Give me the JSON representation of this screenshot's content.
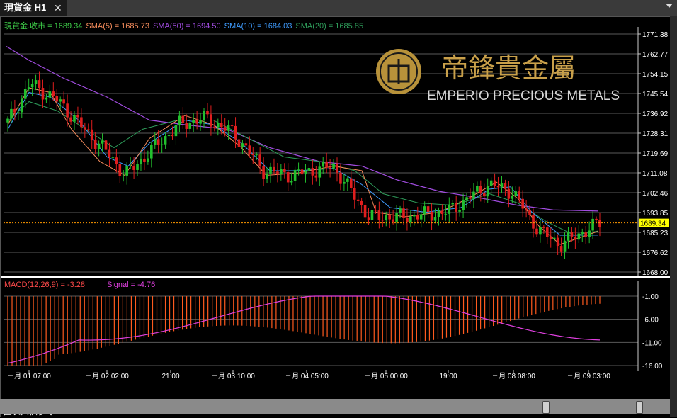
{
  "tab": {
    "label": "現貨金 H1",
    "close": "✕"
  },
  "footer_note": "圖表只供參考",
  "logo": {
    "chinese": "帝鋒貴金屬",
    "english": "EMPERIO PRECIOUS METALS"
  },
  "price_panel": {
    "legend": [
      {
        "text": "現貨金.收市 = 1689.34",
        "color": "#3fd14a"
      },
      {
        "text": "SMA(5) = 1685.73",
        "color": "#f58c5c"
      },
      {
        "text": "SMA(50) = 1694.50",
        "color": "#a14ce0"
      },
      {
        "text": "SMA(10) = 1684.03",
        "color": "#3f9cff"
      },
      {
        "text": "SMA(20) = 1685.85",
        "color": "#2e9c5a"
      }
    ],
    "y_ticks": [
      "1771.38",
      "1762.77",
      "1754.15",
      "1745.54",
      "1736.92",
      "1728.31",
      "1719.69",
      "1711.08",
      "1702.46",
      "1693.85",
      "1685.23",
      "1676.62",
      "1668.00"
    ],
    "current_price": "1689.34"
  },
  "macd_panel": {
    "legend_macd": "MACD(12,26,9) = -3.28",
    "legend_signal": "Signal = -4.76",
    "y_ticks": [
      "-1.00",
      "-6.00",
      "-11.00",
      "-16.00"
    ]
  },
  "x_ticks": [
    "三月 01 07:00",
    "三月 02 02:00",
    "21:00",
    "三月 03 10:00",
    "三月 04 05:00",
    "三月 05 00:00",
    "19:00",
    "三月 08 08:00",
    "三月 09 03:00"
  ],
  "colors": {
    "up": "#22c02e",
    "down": "#e01e1e",
    "grid": "#5a5a5a",
    "close_line": "#ff9900",
    "macd_hist": "#ff5a1e",
    "signal": "#e040e0"
  },
  "chart_data": {
    "type": "candlestick",
    "title": "現貨金 H1",
    "ylim": [
      1668.0,
      1771.38
    ],
    "current_close": 1689.34,
    "indicators": {
      "SMA(5)": 1685.73,
      "SMA(10)": 1684.03,
      "SMA(20)": 1685.85,
      "SMA(50)": 1694.5,
      "MACD(12,26,9)": -3.28,
      "Signal": -4.76
    },
    "macd_ylim": [
      -16.0,
      -1.0
    ],
    "approx_close_path": [
      [
        "三月 01 07:00",
        1733
      ],
      [
        "三月 01 10:00",
        1750
      ],
      [
        "三月 01 14:00",
        1742
      ],
      [
        "三月 01 18:00",
        1730
      ],
      [
        "三月 02 02:00",
        1720
      ],
      [
        "三月 02 06:00",
        1710
      ],
      [
        "三月 02 14:00",
        1722
      ],
      [
        "21:00",
        1732
      ],
      [
        "三月 03 04:00",
        1735
      ],
      [
        "三月 03 10:00",
        1728
      ],
      [
        "三月 03 18:00",
        1712
      ],
      [
        "三月 04 05:00",
        1710
      ],
      [
        "三月 04 16:00",
        1714
      ],
      [
        "三月 05 00:00",
        1692
      ],
      [
        "三月 05 10:00",
        1692
      ],
      [
        "19:00",
        1694
      ],
      [
        "三月 08 02:00",
        1706
      ],
      [
        "三月 08 08:00",
        1703
      ],
      [
        "三月 08 18:00",
        1686
      ],
      [
        "三月 09 00:00",
        1680
      ],
      [
        "三月 09 03:00",
        1689.34
      ]
    ]
  }
}
